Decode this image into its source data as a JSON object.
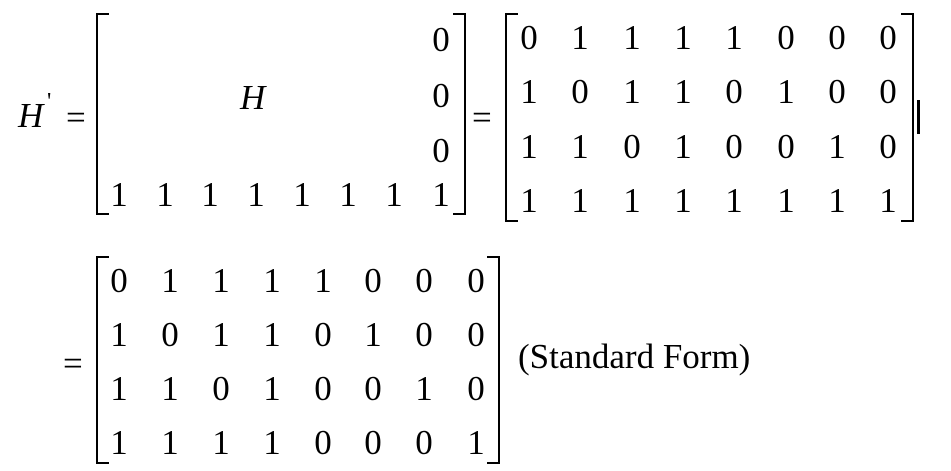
{
  "line1": {
    "lhs": {
      "symbol": "H",
      "prime": "'"
    },
    "equals": "=",
    "block_matrix": {
      "label": "H",
      "last_column": [
        "0",
        "0",
        "0"
      ],
      "bottom_row": [
        "1",
        "1",
        "1",
        "1",
        "1",
        "1",
        "1",
        "1"
      ]
    },
    "equals_2": "=",
    "expanded_matrix": [
      [
        "0",
        "1",
        "1",
        "1",
        "1",
        "0",
        "0",
        "0"
      ],
      [
        "1",
        "0",
        "1",
        "1",
        "0",
        "1",
        "0",
        "0"
      ],
      [
        "1",
        "1",
        "0",
        "1",
        "0",
        "0",
        "1",
        "0"
      ],
      [
        "1",
        "1",
        "1",
        "1",
        "1",
        "1",
        "1",
        "1"
      ]
    ],
    "trailing_mark": "|"
  },
  "line2": {
    "equals": "=",
    "standard_matrix": [
      [
        "0",
        "1",
        "1",
        "1",
        "1",
        "0",
        "0",
        "0"
      ],
      [
        "1",
        "0",
        "1",
        "1",
        "0",
        "1",
        "0",
        "0"
      ],
      [
        "1",
        "1",
        "0",
        "1",
        "0",
        "0",
        "1",
        "0"
      ],
      [
        "1",
        "1",
        "1",
        "1",
        "0",
        "0",
        "0",
        "1"
      ]
    ],
    "annotation": "(Standard Form)"
  }
}
